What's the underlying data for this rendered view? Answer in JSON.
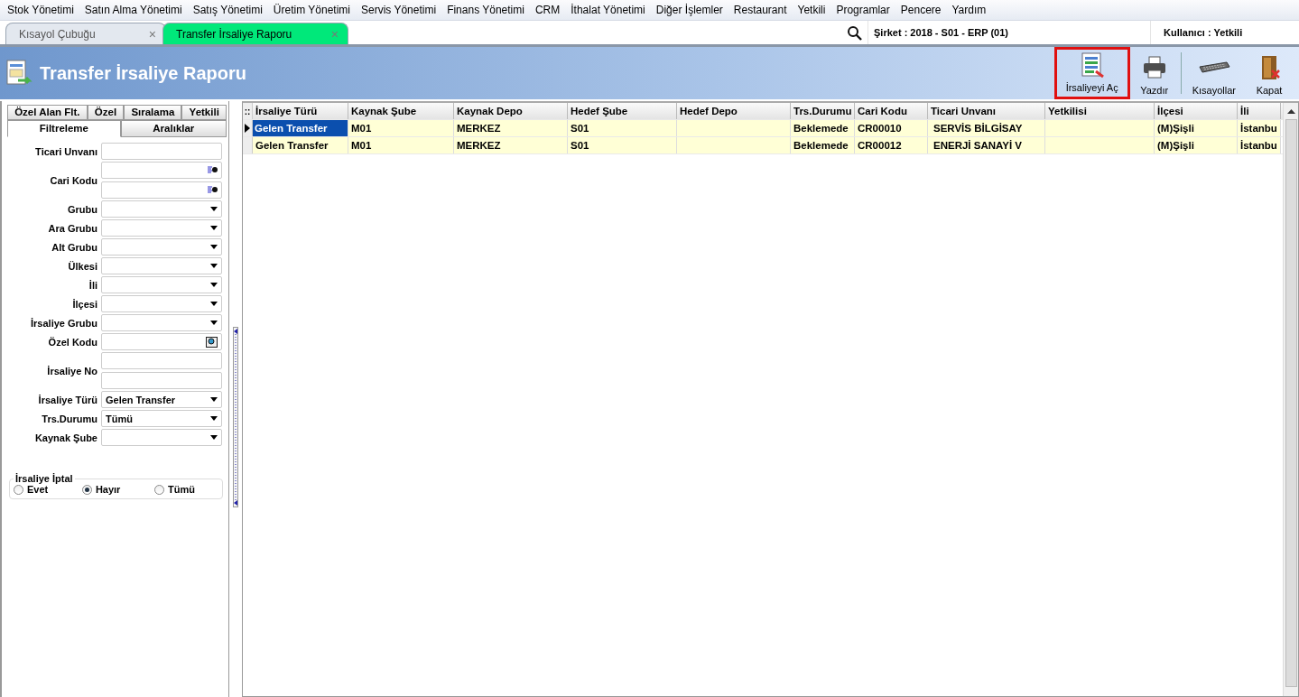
{
  "menu": [
    "Stok Yönetimi",
    "Satın Alma Yönetimi",
    "Satış Yönetimi",
    "Üretim Yönetimi",
    "Servis Yönetimi",
    "Finans Yönetimi",
    "CRM",
    "İthalat Yönetimi",
    "Diğer İşlemler",
    "Restaurant",
    "Yetkili",
    "Programlar",
    "Pencere",
    "Yardım"
  ],
  "tabs": [
    {
      "label": "Kısayol Çubuğu",
      "close": "×",
      "selected": false
    },
    {
      "label": "Transfer İrsaliye Raporu",
      "close": "×",
      "selected": true
    }
  ],
  "status": {
    "company": "Şirket : 2018 - S01 - ERP (01)",
    "user": "Kullanıcı : Yetkili"
  },
  "header": {
    "title": "Transfer İrsaliye Raporu"
  },
  "toolbar": [
    {
      "label": "İrsaliyeyi Aç",
      "kind": "open",
      "highlighted": true
    },
    {
      "label": "Yazdır",
      "kind": "print",
      "highlighted": false
    },
    {
      "label": "Kısayollar",
      "kind": "shortcuts",
      "highlighted": false
    },
    {
      "label": "Kapat",
      "kind": "close",
      "highlighted": false
    }
  ],
  "filter_tabs": [
    [
      {
        "label": "Özel Alan Flt.",
        "selected": false
      },
      {
        "label": "Özel",
        "selected": false
      },
      {
        "label": "Sıralama",
        "selected": false
      },
      {
        "label": "Yetkili",
        "selected": false
      }
    ],
    [
      {
        "label": "Filtreleme",
        "selected": true
      },
      {
        "label": "Aralıklar",
        "selected": false
      }
    ]
  ],
  "filters": [
    {
      "label": "Ticari Unvanı",
      "kind": "text"
    },
    {
      "label": "Cari Kodu",
      "kind": "lookup_pair"
    },
    {
      "label": "Grubu",
      "kind": "combo"
    },
    {
      "label": "Ara Grubu",
      "kind": "combo"
    },
    {
      "label": "Alt Grubu",
      "kind": "combo"
    },
    {
      "label": "Ülkesi",
      "kind": "combo"
    },
    {
      "label": "İli",
      "kind": "combo"
    },
    {
      "label": "İlçesi",
      "kind": "combo"
    },
    {
      "label": "İrsaliye Grubu",
      "kind": "combo"
    },
    {
      "label": "Özel Kodu",
      "kind": "search"
    },
    {
      "label": "İrsaliye No",
      "kind": "text_pair"
    },
    {
      "label": "İrsaliye Türü",
      "kind": "combo",
      "value": "Gelen Transfer"
    },
    {
      "label": "Trs.Durumu",
      "kind": "combo",
      "value": "Tümü"
    },
    {
      "label": "Kaynak Şube",
      "kind": "combo"
    }
  ],
  "cancel_group": {
    "title": "İrsaliye İptal",
    "options": [
      {
        "label": "Evet",
        "selected": false
      },
      {
        "label": "Hayır",
        "selected": true
      },
      {
        "label": "Tümü",
        "selected": false
      }
    ]
  },
  "grid": {
    "corner": "::",
    "columns": [
      "İrsaliye Türü",
      "Kaynak Şube",
      "Kaynak Depo",
      "Hedef Şube",
      "Hedef Depo",
      "Trs.Durumu",
      "Cari Kodu",
      "Ticari Unvanı",
      "Yetkilisi",
      "İlçesi",
      "İli"
    ],
    "rows": [
      {
        "selected": true,
        "cells": [
          "Gelen Transfer",
          "M01",
          "MERKEZ",
          "S01",
          "",
          "Beklemede",
          "CR00010",
          "SERVİS BİLGİSAY",
          "",
          "(M)Şişli",
          "İstanbu"
        ]
      },
      {
        "selected": false,
        "cells": [
          "Gelen Transfer",
          "M01",
          "MERKEZ",
          "S01",
          "",
          "Beklemede",
          "CR00012",
          "ENERJİ SANAYİ V",
          "",
          "(M)Şişli",
          "İstanbu"
        ]
      }
    ]
  }
}
